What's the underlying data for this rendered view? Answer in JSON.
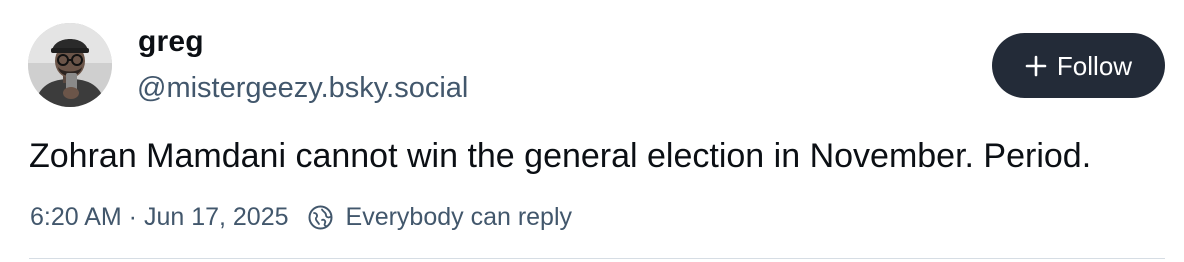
{
  "author": {
    "display_name": "greg",
    "handle": "@mistergeezy.bsky.social",
    "avatar": "user-avatar"
  },
  "follow_button": {
    "label": "Follow",
    "icon": "plus-icon",
    "background": "#232b38"
  },
  "post": {
    "text": "Zohran Mamdani cannot win the general election in November. Period.",
    "timestamp": "6:20 AM · Jun 17, 2025",
    "reply_setting": "Everybody can reply",
    "reply_icon": "globe-reply-icon"
  },
  "colors": {
    "text_primary": "#0b0f14",
    "text_secondary": "#42576c",
    "divider": "#d6dde4"
  }
}
